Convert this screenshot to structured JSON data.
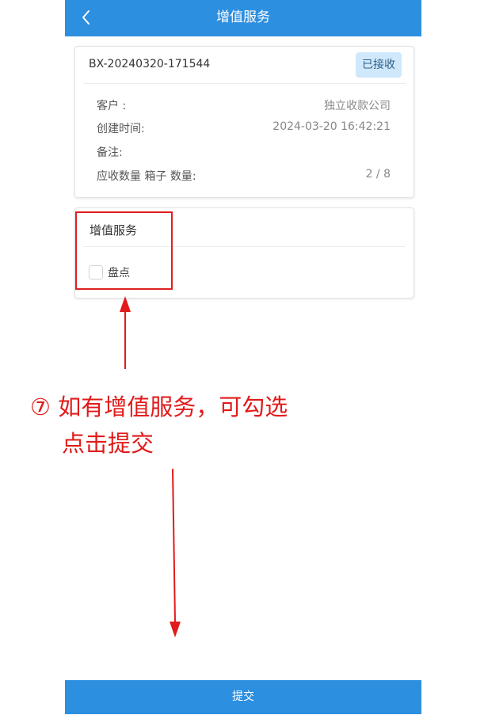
{
  "header": {
    "title": "增值服务",
    "back_icon": "chevron-left-icon"
  },
  "order": {
    "number": "BX-20240320-171544",
    "status": "已接收",
    "fields": [
      {
        "label": "客户 :",
        "value": "独立收款公司"
      },
      {
        "label": "创建时间:",
        "value": "2024-03-20 16:42:21"
      },
      {
        "label": "备注:",
        "value": ""
      },
      {
        "label": "应收数量 箱子 数量:",
        "value": "2 / 8"
      }
    ]
  },
  "value_added": {
    "title": "增值服务",
    "options": [
      {
        "label": "盘点",
        "checked": false
      }
    ]
  },
  "annotation": {
    "line1": "⑦ 如有增值服务，可勾选",
    "line2": "点击提交"
  },
  "submit": {
    "label": "提交"
  },
  "colors": {
    "primary": "#2d8fe0",
    "badge_bg": "#cfe8fb",
    "annotation_red": "#e11a1a"
  }
}
